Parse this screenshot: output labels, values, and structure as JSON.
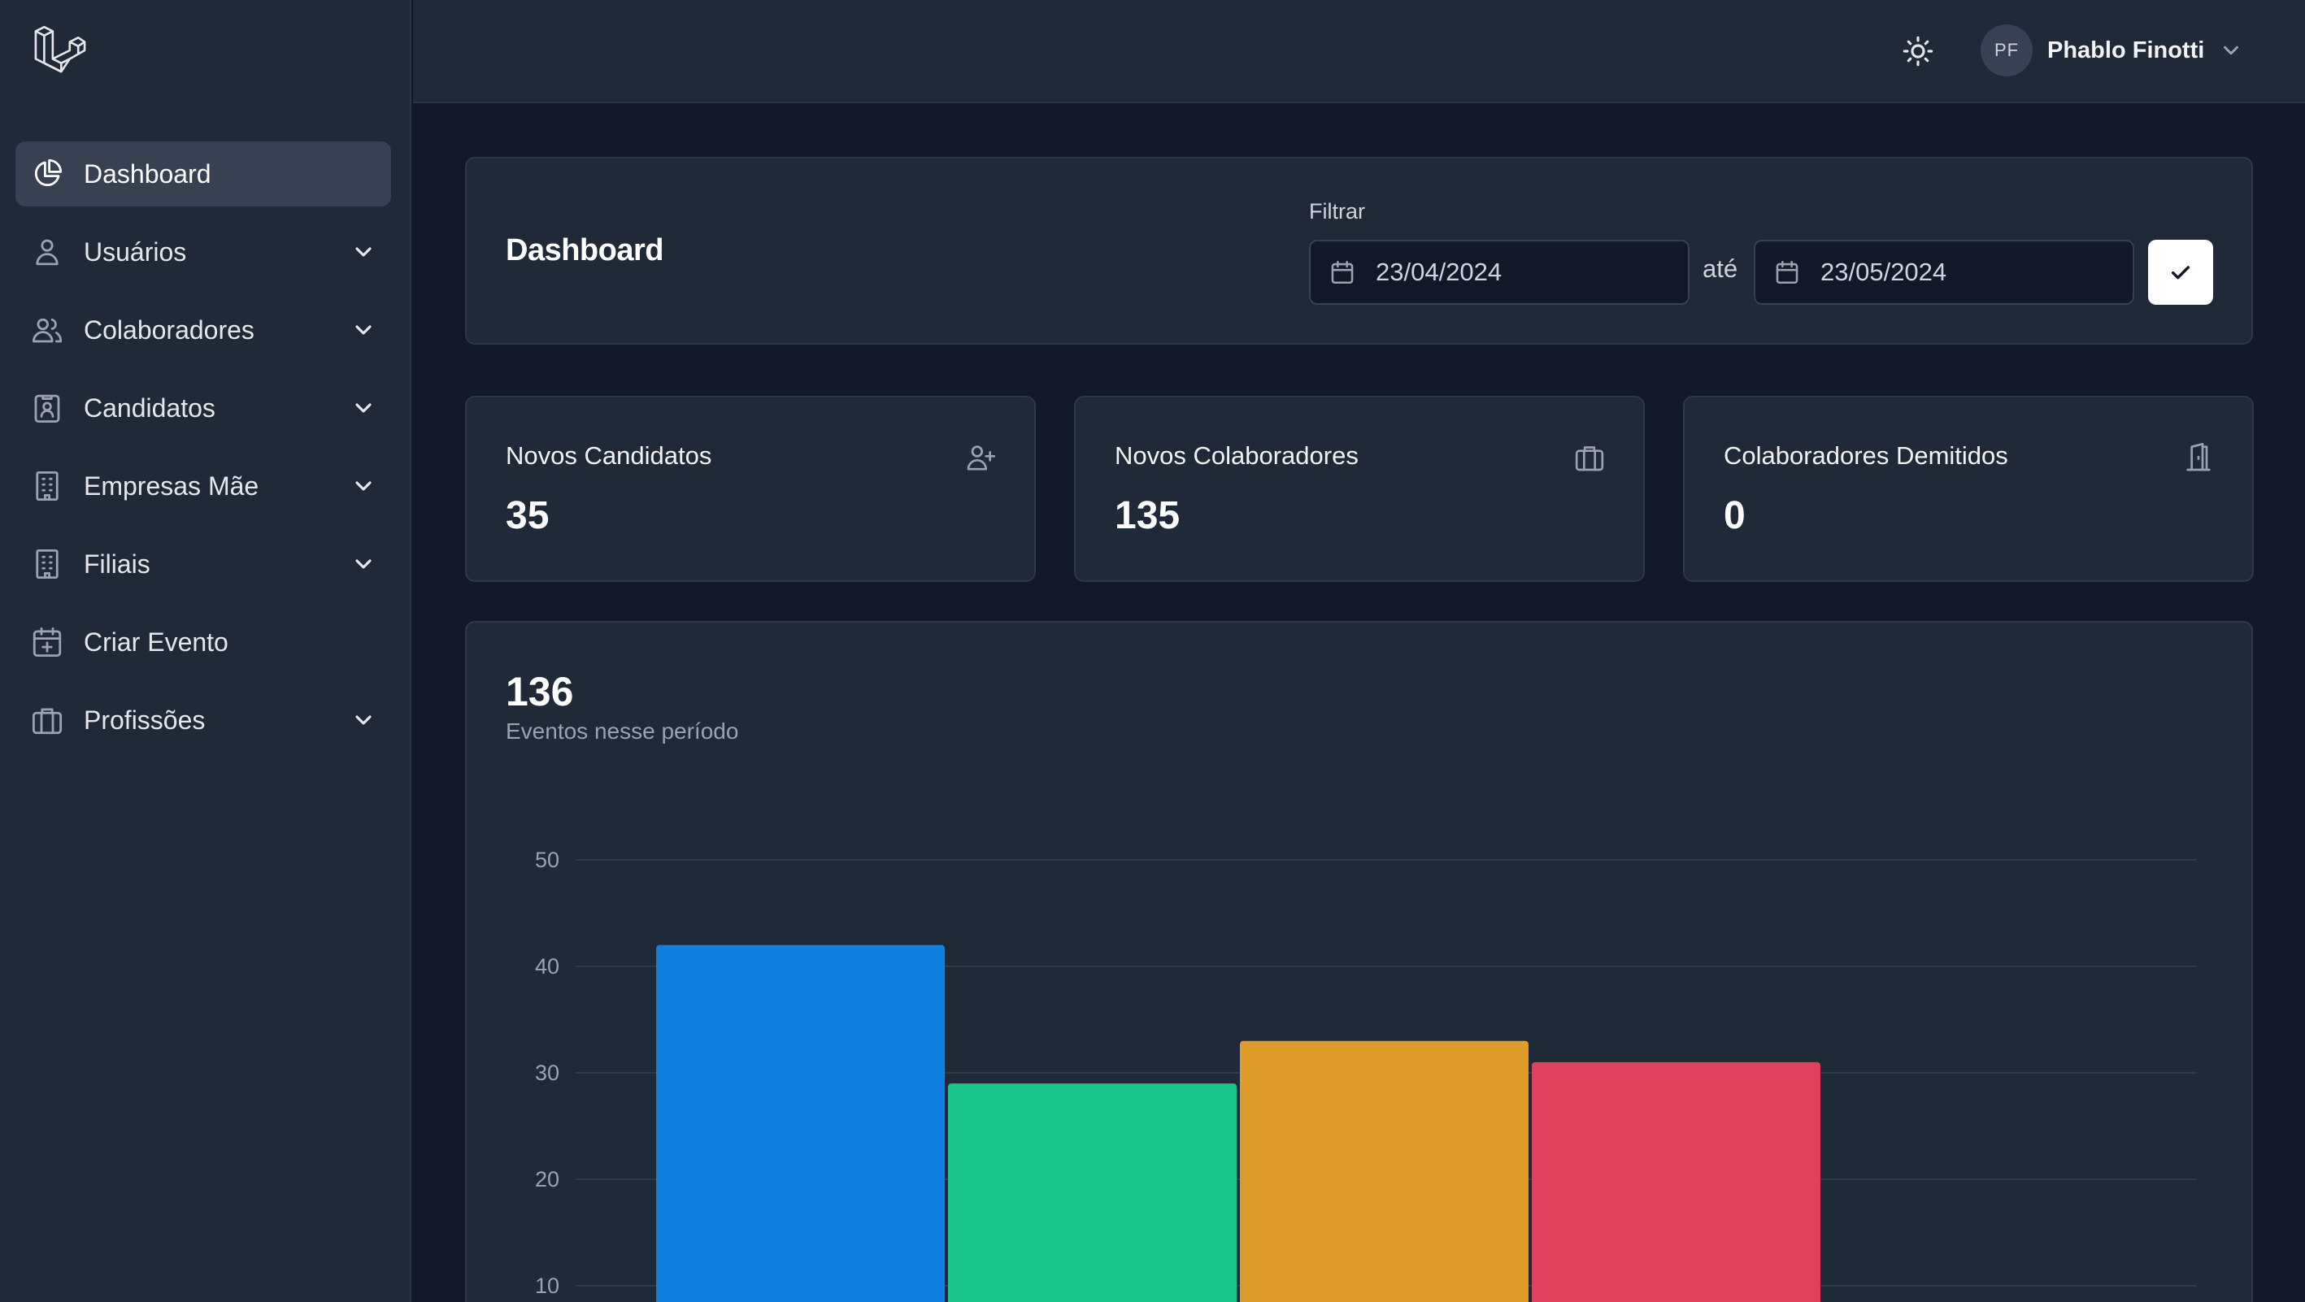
{
  "user": {
    "initials": "PF",
    "name": "Phablo Finotti"
  },
  "sidebar": {
    "items": [
      {
        "label": "Dashboard",
        "icon": "pie-chart-icon",
        "active": true,
        "expandable": false
      },
      {
        "label": "Usuários",
        "icon": "user-icon",
        "active": false,
        "expandable": true
      },
      {
        "label": "Colaboradores",
        "icon": "users-icon",
        "active": false,
        "expandable": true
      },
      {
        "label": "Candidatos",
        "icon": "id-badge-icon",
        "active": false,
        "expandable": true
      },
      {
        "label": "Empresas Mãe",
        "icon": "building-icon",
        "active": false,
        "expandable": true
      },
      {
        "label": "Filiais",
        "icon": "building-icon",
        "active": false,
        "expandable": true
      },
      {
        "label": "Criar Evento",
        "icon": "calendar-plus-icon",
        "active": false,
        "expandable": false
      },
      {
        "label": "Profissões",
        "icon": "briefcase-icon",
        "active": false,
        "expandable": true
      }
    ]
  },
  "header": {
    "title": "Dashboard",
    "filter_label": "Filtrar",
    "date_from": "23/04/2024",
    "between_label": "até",
    "date_to": "23/05/2024"
  },
  "stats": [
    {
      "label": "Novos Candidatos",
      "value": "35",
      "icon": "user-plus-icon"
    },
    {
      "label": "Novos Colaboradores",
      "value": "135",
      "icon": "briefcase-icon"
    },
    {
      "label": "Colaboradores Demitidos",
      "value": "0",
      "icon": "door-exit-icon"
    }
  ],
  "events": {
    "value": "136",
    "caption": "Eventos nesse período"
  },
  "chart_data": {
    "type": "bar",
    "categories": [
      "",
      "",
      "",
      ""
    ],
    "values": [
      42,
      29,
      33,
      31
    ],
    "colors": [
      "#0f7fe0",
      "#1ac68b",
      "#dd9b29",
      "#df425d"
    ],
    "ylim": [
      0,
      50
    ],
    "yticks": [
      10,
      20,
      30,
      40,
      50
    ],
    "grid": true
  }
}
